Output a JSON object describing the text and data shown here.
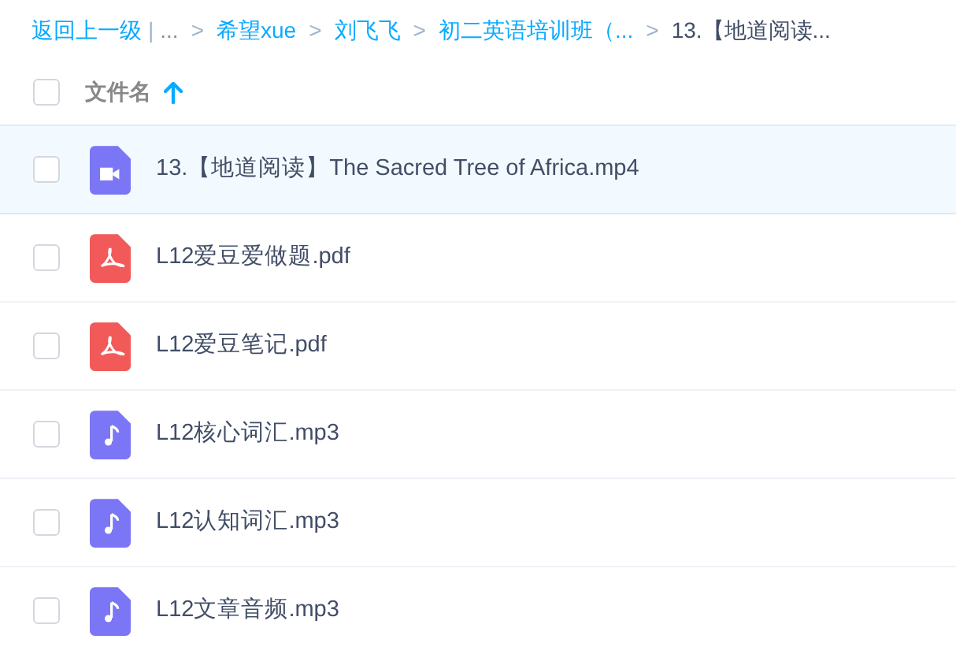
{
  "breadcrumb": {
    "back": "返回上一级",
    "divider": "|",
    "items": [
      {
        "text": "...",
        "kind": "ellipsis"
      },
      {
        "text": "希望xue",
        "kind": "link",
        "arrow": ">"
      },
      {
        "text": "刘飞飞",
        "kind": "link",
        "arrow": ">"
      },
      {
        "text": "初二英语培训班（...",
        "kind": "link",
        "arrow": ">"
      },
      {
        "text": "13.【地道阅读...",
        "kind": "current",
        "arrow": ">"
      }
    ]
  },
  "header": {
    "checked": false,
    "label": "文件名",
    "sort_ascending": true
  },
  "files": [
    {
      "name": "13.【地道阅读】The Sacred Tree of Africa.mp4",
      "kind": "video",
      "checked": false,
      "highlighted": true
    },
    {
      "name": "L12爱豆爱做题.pdf",
      "kind": "pdf",
      "checked": false,
      "highlighted": false
    },
    {
      "name": "L12爱豆笔记.pdf",
      "kind": "pdf",
      "checked": false,
      "highlighted": false
    },
    {
      "name": "L12核心词汇.mp3",
      "kind": "audio",
      "checked": false,
      "highlighted": false
    },
    {
      "name": "L12认知词汇.mp3",
      "kind": "audio",
      "checked": false,
      "highlighted": false
    },
    {
      "name": "L12文章音频.mp3",
      "kind": "audio",
      "checked": false,
      "highlighted": false
    }
  ]
}
